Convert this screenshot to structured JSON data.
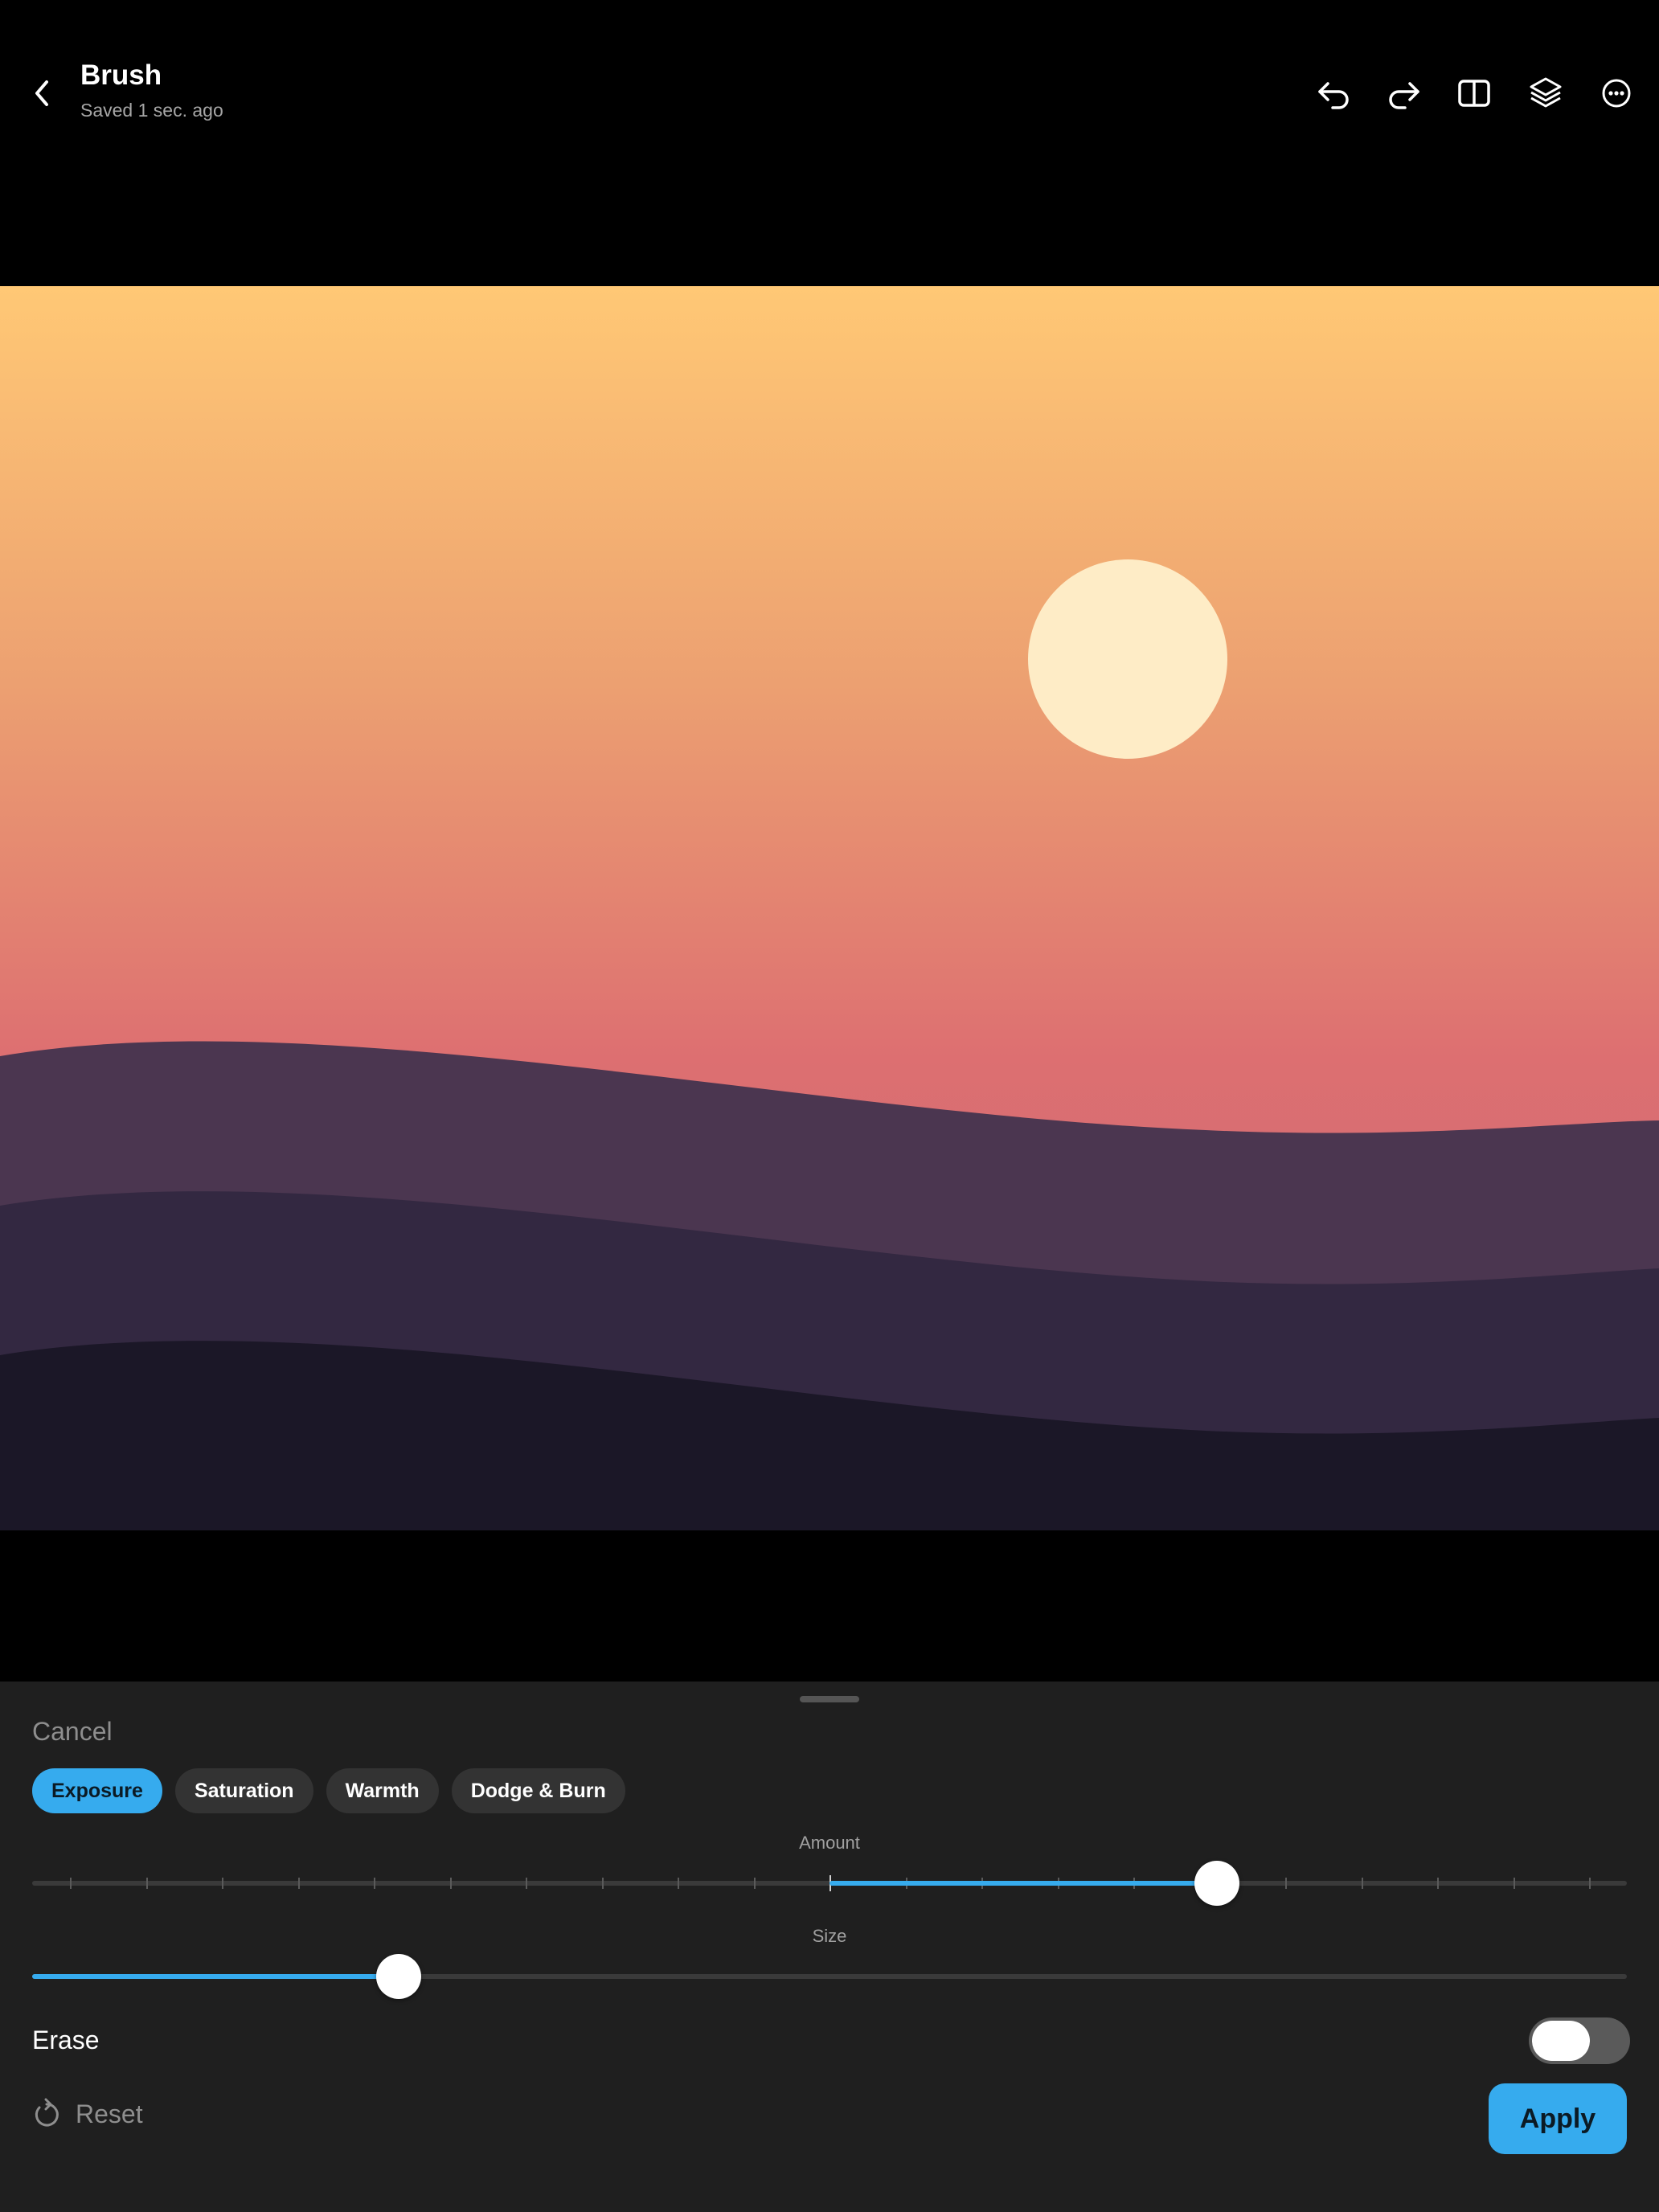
{
  "header": {
    "title": "Brush",
    "subtitle": "Saved 1 sec. ago",
    "icons": [
      "chevron-left-icon",
      "undo-icon",
      "redo-icon",
      "compare-icon",
      "layers-icon",
      "more-icon"
    ]
  },
  "canvas": {
    "sky_colors": [
      "#ffc875",
      "#eca071",
      "#dd6f71",
      "#c16b75"
    ],
    "sun_color": "#feecc6",
    "hill_colors": [
      "#4b3650",
      "#332841",
      "#1b1727"
    ]
  },
  "panel": {
    "cancel_label": "Cancel",
    "tabs": [
      {
        "label": "Exposure",
        "active": true
      },
      {
        "label": "Saturation",
        "active": false
      },
      {
        "label": "Warmth",
        "active": false
      },
      {
        "label": "Dodge & Burn",
        "active": false
      }
    ],
    "amount": {
      "label": "Amount",
      "value_fraction": 0.743,
      "center_fraction": 0.5
    },
    "size": {
      "label": "Size",
      "value_fraction": 0.23
    },
    "erase": {
      "label": "Erase",
      "on": false
    },
    "reset_label": "Reset",
    "apply_label": "Apply",
    "accent_color": "#36abee"
  }
}
